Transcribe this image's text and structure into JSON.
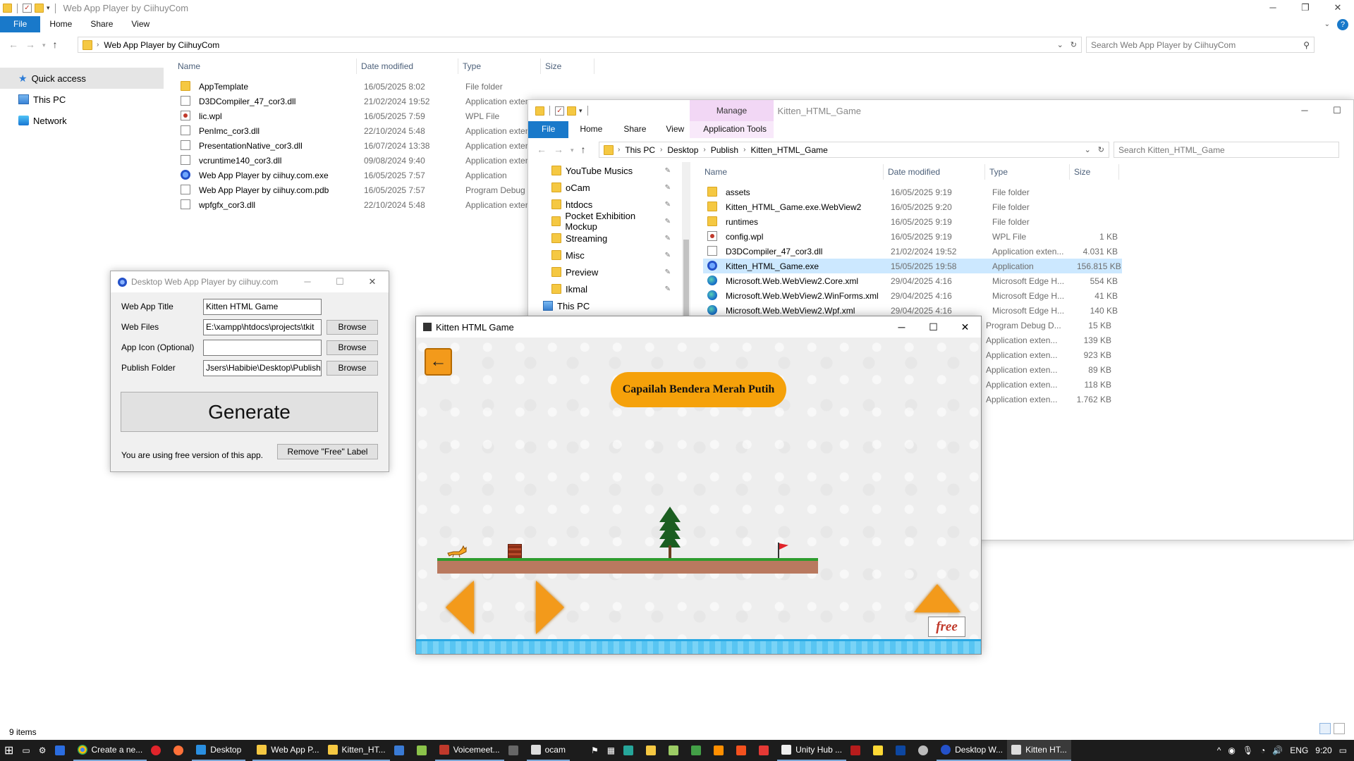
{
  "win1": {
    "title": "Web App Player by CiihuyCom",
    "ribbon_tabs": [
      "File",
      "Home",
      "Share",
      "View"
    ],
    "breadcrumb": "Web App Player by CiihuyCom",
    "search_placeholder": "Search Web App Player by CiihuyCom",
    "columns": [
      "Name",
      "Date modified",
      "Type",
      "Size"
    ],
    "sidebar": [
      "Quick access",
      "This PC",
      "Network"
    ],
    "files": [
      {
        "name": "AppTemplate",
        "date": "16/05/2025 8:02",
        "type": "File folder",
        "size": "",
        "icon": "folder"
      },
      {
        "name": "D3DCompiler_47_cor3.dll",
        "date": "21/02/2024 19:52",
        "type": "Application exten",
        "size": "",
        "icon": "file"
      },
      {
        "name": "lic.wpl",
        "date": "16/05/2025 7:59",
        "type": "WPL File",
        "size": "",
        "icon": "wpl"
      },
      {
        "name": "PenImc_cor3.dll",
        "date": "22/10/2024 5:48",
        "type": "Application exten",
        "size": "",
        "icon": "file"
      },
      {
        "name": "PresentationNative_cor3.dll",
        "date": "16/07/2024 13:38",
        "type": "Application exten",
        "size": "",
        "icon": "file"
      },
      {
        "name": "vcruntime140_cor3.dll",
        "date": "09/08/2024 9:40",
        "type": "Application exten",
        "size": "",
        "icon": "file"
      },
      {
        "name": "Web App Player by ciihuy.com.exe",
        "date": "16/05/2025 7:57",
        "type": "Application",
        "size": "",
        "icon": "app"
      },
      {
        "name": "Web App Player by ciihuy.com.pdb",
        "date": "16/05/2025 7:57",
        "type": "Program Debug D",
        "size": "",
        "icon": "file"
      },
      {
        "name": "wpfgfx_cor3.dll",
        "date": "22/10/2024 5:48",
        "type": "Application exten",
        "size": "",
        "icon": "file"
      }
    ],
    "status": "9 items"
  },
  "win2": {
    "title": "Kitten_HTML_Game",
    "manage_label": "Manage",
    "ribbon_tabs": [
      "File",
      "Home",
      "Share",
      "View",
      "Application Tools"
    ],
    "breadcrumb": [
      "This PC",
      "Desktop",
      "Publish",
      "Kitten_HTML_Game"
    ],
    "search_placeholder": "Search Kitten_HTML_Game",
    "columns": [
      "Name",
      "Date modified",
      "Type",
      "Size"
    ],
    "tree": [
      "YouTube Musics",
      "oCam",
      "htdocs",
      "Pocket Exhibition Mockup",
      "Streaming",
      "Misc",
      "Preview",
      "Ikmal",
      "This PC"
    ],
    "files": [
      {
        "name": "assets",
        "date": "16/05/2025 9:19",
        "type": "File folder",
        "size": "",
        "icon": "folder"
      },
      {
        "name": "Kitten_HTML_Game.exe.WebView2",
        "date": "16/05/2025 9:20",
        "type": "File folder",
        "size": "",
        "icon": "folder"
      },
      {
        "name": "runtimes",
        "date": "16/05/2025 9:19",
        "type": "File folder",
        "size": "",
        "icon": "folder"
      },
      {
        "name": "config.wpl",
        "date": "16/05/2025 9:19",
        "type": "WPL File",
        "size": "1 KB",
        "icon": "wpl"
      },
      {
        "name": "D3DCompiler_47_cor3.dll",
        "date": "21/02/2024 19:52",
        "type": "Application exten...",
        "size": "4.031 KB",
        "icon": "file"
      },
      {
        "name": "Kitten_HTML_Game.exe",
        "date": "15/05/2025 19:58",
        "type": "Application",
        "size": "156.815 KB",
        "icon": "app"
      },
      {
        "name": "Microsoft.Web.WebView2.Core.xml",
        "date": "29/04/2025 4:16",
        "type": "Microsoft Edge H...",
        "size": "554 KB",
        "icon": "edge"
      },
      {
        "name": "Microsoft.Web.WebView2.WinForms.xml",
        "date": "29/04/2025 4:16",
        "type": "Microsoft Edge H...",
        "size": "41 KB",
        "icon": "edge"
      },
      {
        "name": "Microsoft.Web.WebView2.Wpf.xml",
        "date": "29/04/2025 4:16",
        "type": "Microsoft Edge H...",
        "size": "140 KB",
        "icon": "edge"
      }
    ],
    "hidden_rows": [
      {
        "type": "Program Debug D...",
        "size": "15 KB"
      },
      {
        "type": "Application exten...",
        "size": "139 KB"
      },
      {
        "type": "Application exten...",
        "size": "923 KB"
      },
      {
        "type": "Application exten...",
        "size": "89 KB"
      },
      {
        "type": "Application exten...",
        "size": "118 KB"
      },
      {
        "type": "Application exten...",
        "size": "1.762 KB"
      }
    ]
  },
  "dialog": {
    "title": "Desktop Web App Player by ciihuy.com",
    "fields": [
      {
        "label": "Web App Title",
        "value": "Kitten HTML Game",
        "has_browse": false
      },
      {
        "label": "Web Files",
        "value": "E:\\xampp\\htdocs\\projects\\tkit",
        "has_browse": true
      },
      {
        "label": "App Icon (Optional)",
        "value": "",
        "has_browse": true
      },
      {
        "label": "Publish Folder",
        "value": "Jsers\\Habibie\\Desktop\\Publish",
        "has_browse": true
      }
    ],
    "browse_label": "Browse",
    "generate_label": "Generate",
    "free_text": "You are using free version of this app.",
    "remove_label": "Remove \"Free\" Label"
  },
  "game": {
    "title": "Kitten HTML Game",
    "banner": "Capailah Bendera Merah Putih",
    "free_label": "free"
  },
  "taskbar": {
    "items": [
      "Create a ne...",
      "Desktop",
      "Web App P...",
      "Kitten_HT...",
      "Voicemeet...",
      "ocam",
      "Unity Hub ...",
      "Desktop W...",
      "Kitten HT..."
    ],
    "lang": "ENG",
    "time": "9:20"
  },
  "colors": {
    "accent": "#1979ca",
    "selection": "#cce8ff",
    "game_orange": "#f5a10a"
  }
}
